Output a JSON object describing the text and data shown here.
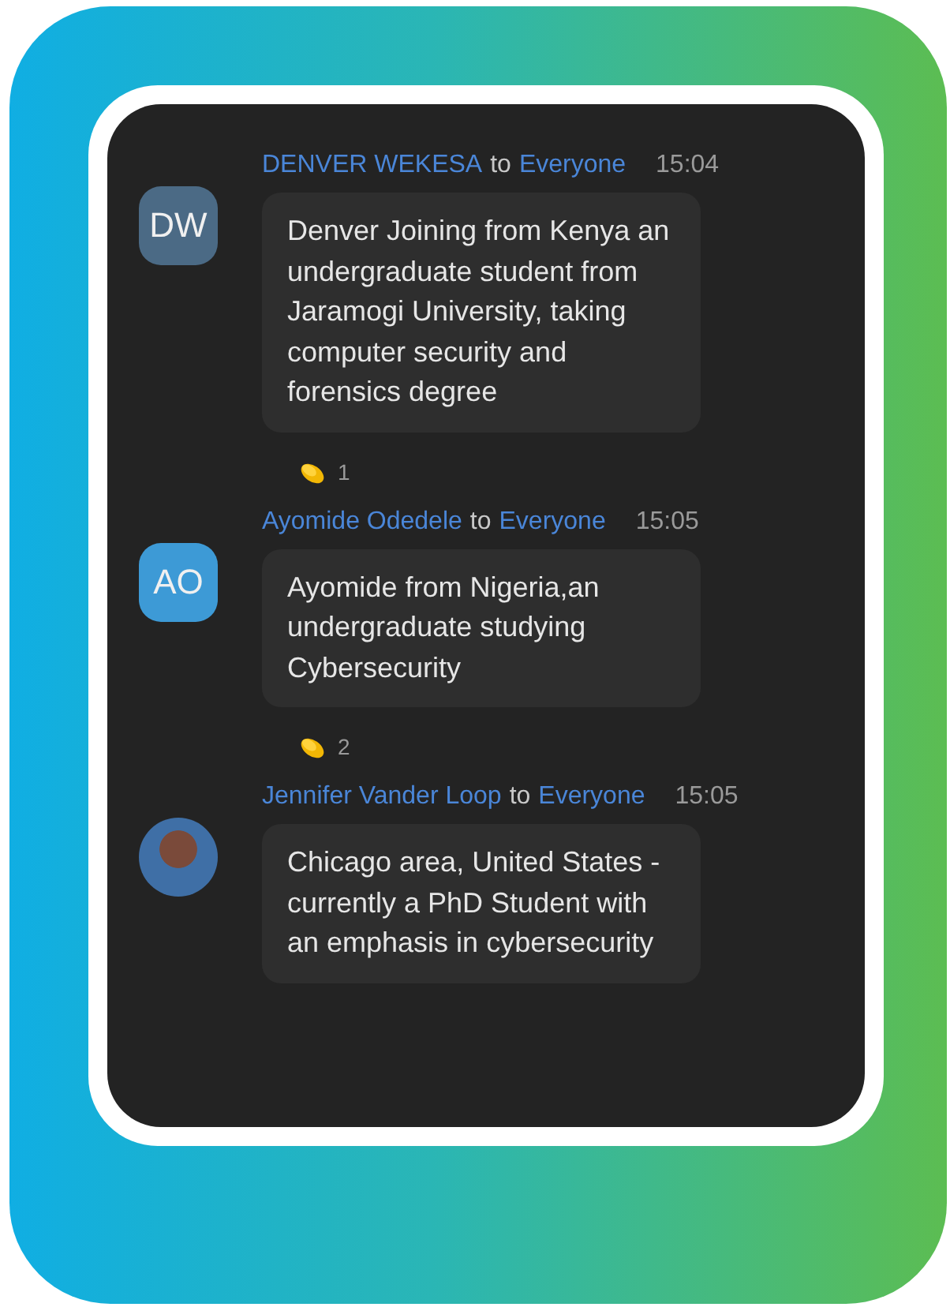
{
  "messages": [
    {
      "initials": "DW",
      "kind": "initials",
      "sender": "DENVER WEKESA",
      "connector": "to",
      "recipient": "Everyone",
      "time": "15:04",
      "text": "Denver Joining from Kenya an undergraduate student from Jaramogi University, taking computer security and forensics degree",
      "reaction_count": "1"
    },
    {
      "initials": "AO",
      "kind": "initials",
      "sender": "Ayomide Odedele",
      "connector": "to",
      "recipient": "Everyone",
      "time": "15:05",
      "text": "Ayomide from Nigeria,an undergraduate studying Cybersecurity",
      "reaction_count": "2"
    },
    {
      "kind": "photo",
      "sender": "Jennifer Vander Loop",
      "connector": "to",
      "recipient": "Everyone",
      "time": "15:05",
      "text": "Chicago area, United States - currently a PhD Student with an emphasis in cybersecurity"
    }
  ]
}
